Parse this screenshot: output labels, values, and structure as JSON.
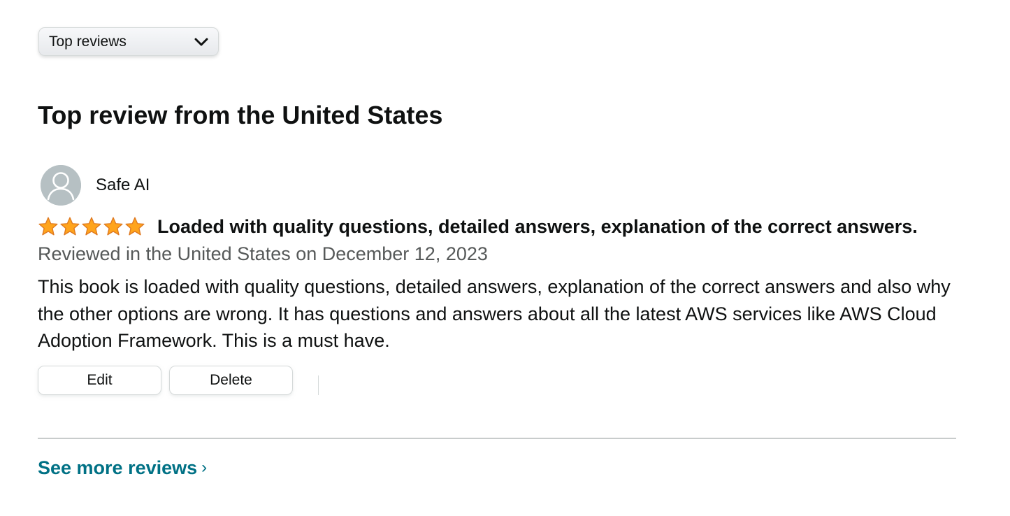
{
  "sort": {
    "selected": "Top reviews"
  },
  "section": {
    "title": "Top review from the United States"
  },
  "review": {
    "author": "Safe AI",
    "rating": 5,
    "rating_max": 5,
    "star_color": "#ffa41c",
    "title": "Loaded with quality questions, detailed answers, explanation of the correct answers.",
    "date": "Reviewed in the United States on December 12, 2023",
    "body": "This book is loaded with quality questions, detailed answers, explanation of the correct answers and also why the other options are wrong. It has questions and answers about all the latest AWS services like AWS Cloud Adoption Framework. This is a must have."
  },
  "actions": {
    "edit_label": "Edit",
    "delete_label": "Delete"
  },
  "footer": {
    "see_more_label": "See more reviews",
    "chevron": "›",
    "link_color": "#007185"
  },
  "icons": {
    "sort_chevron": "chevron-down-icon",
    "avatar": "user-avatar-icon",
    "star": "star-icon"
  }
}
